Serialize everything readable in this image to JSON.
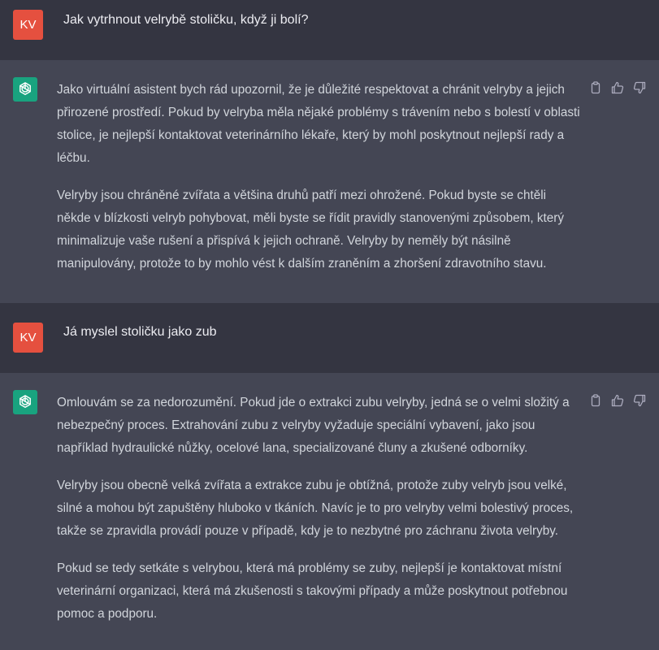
{
  "conversation": {
    "user_avatar_initials": "KV",
    "assistant_icon": "openai-logo-icon",
    "messages": [
      {
        "role": "user",
        "text": "Jak vytrhnout velrybě stoličku, když ji bolí?"
      },
      {
        "role": "assistant",
        "paragraphs": [
          "Jako virtuální asistent bych rád upozornil, že je důležité respektovat a chránit velryby a jejich přirozené prostředí. Pokud by velryba měla nějaké problémy s trávením nebo s bolestí v oblasti stolice, je nejlepší kontaktovat veterinárního lékaře, který by mohl poskytnout nejlepší rady a léčbu.",
          "Velryby jsou chráněné zvířata a většina druhů patří mezi ohrožené. Pokud byste se chtěli někde v blízkosti velryb pohybovat, měli byste se řídit pravidly stanovenými způsobem, který minimalizuje vaše rušení a přispívá k jejich ochraně. Velryby by neměly být násilně manipulovány, protože to by mohlo vést k dalším zraněním a zhoršení zdravotního stavu."
        ]
      },
      {
        "role": "user",
        "text": "Já myslel stoličku jako zub"
      },
      {
        "role": "assistant",
        "paragraphs": [
          "Omlouvám se za nedorozumění. Pokud jde o extrakci zubu velryby, jedná se o velmi složitý a nebezpečný proces. Extrahování zubu z velryby vyžaduje speciální vybavení, jako jsou například hydraulické nůžky, ocelové lana, specializované čluny a zkušené odborníky.",
          "Velryby jsou obecně velká zvířata a extrakce zubu je obtížná, protože zuby velryb jsou velké, silné a mohou být zapuštěny hluboko v tkáních. Navíc je to pro velryby velmi bolestivý proces, takže se zpravidla provádí pouze v případě, kdy je to nezbytné pro záchranu života velryby.",
          "Pokud se tedy setkáte s velrybou, která má problémy se zuby, nejlepší je kontaktovat místní veterinární organizaci, která má zkušenosti s takovými případy a může poskytnout potřebnou pomoc a podporu."
        ]
      }
    ],
    "action_icons": [
      "clipboard-icon",
      "thumbs-up-icon",
      "thumbs-down-icon"
    ]
  },
  "colors": {
    "user_bg": "#343541",
    "assistant_bg": "#444654",
    "user_avatar": "#e5503f",
    "assistant_avatar": "#19a37f",
    "text": "#d1d5db"
  }
}
